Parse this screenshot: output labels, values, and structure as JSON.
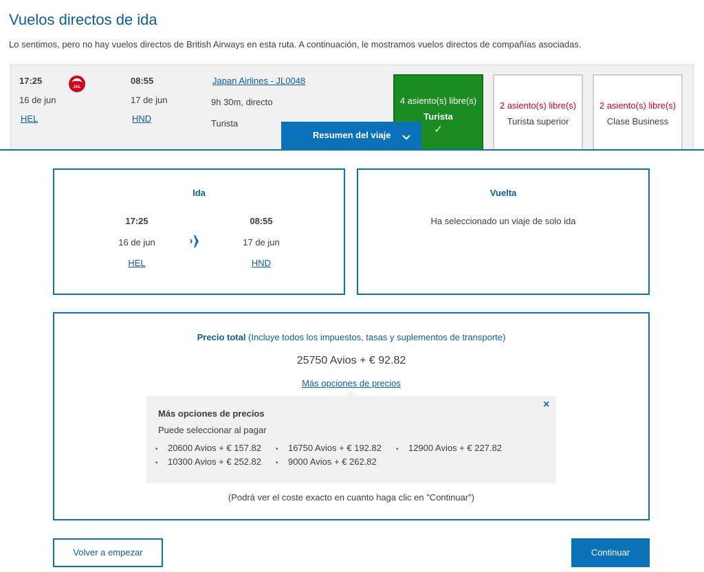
{
  "page": {
    "title": "Vuelos directos de ida",
    "notice": "Lo sentimos, pero no hay vuelos directos de British Airways en esta ruta. A continuación, le mostramos vuelos directos de compañías asociadas."
  },
  "flight": {
    "dep_time": "17:25",
    "dep_date": "16 de jun",
    "dep_airport": "HEL",
    "arr_time": "08:55",
    "arr_date": "17 de jun",
    "arr_airport": "HND",
    "airline_link": "Japan Airlines - JL0048",
    "duration": "9h 30m, directo",
    "cabin": "Turista",
    "airline_logo_icon": "jal-crane-logo-icon",
    "brand_red": "#d4001a"
  },
  "cabins": [
    {
      "seats": "4 asiento(s) libre(s)",
      "name": "Turista",
      "selected": true
    },
    {
      "seats": "2 asiento(s) libre(s)",
      "name": "Turista superior",
      "selected": false
    },
    {
      "seats": "2 asiento(s) libre(s)",
      "name": "Clase Business",
      "selected": false
    }
  ],
  "summary_toggle": {
    "label": "Resumen del viaje",
    "icon": "chevron-down-icon"
  },
  "outbound": {
    "title": "Ida",
    "dep_time": "17:25",
    "dep_date": "16 de jun",
    "dep_airport": "HEL",
    "arr_time": "08:55",
    "arr_date": "17 de jun",
    "arr_airport": "HND",
    "icon": "airplane-icon"
  },
  "return": {
    "title": "Vuelta",
    "message": "Ha seleccionado un viaje de solo ida"
  },
  "price": {
    "label_bold": "Precio total",
    "label_rest": " (Incluye todos los impuestos, tasas y suplementos de transporte)",
    "total": "25750 Avios + € 92.82",
    "more_link": "Más opciones de precios",
    "note": "(Podrá ver el coste exacto en cuanto haga clic en \"Continuar\")"
  },
  "options_popup": {
    "title": "Más opciones de precios",
    "subtitle": "Puede seleccionar al pagar",
    "options": [
      "20600 Avios + € 157.82",
      "16750 Avios + € 192.82",
      "12900 Avios + € 227.82",
      "10300 Avios + € 252.82",
      "9000 Avios + € 262.82"
    ],
    "close_icon": "close-icon"
  },
  "buttons": {
    "restart": "Volver a empezar",
    "continue": "Continuar"
  },
  "colors": {
    "primary_blue": "#0a72b8",
    "selected_green": "#1a8c21",
    "seats_red": "#d4001a"
  }
}
